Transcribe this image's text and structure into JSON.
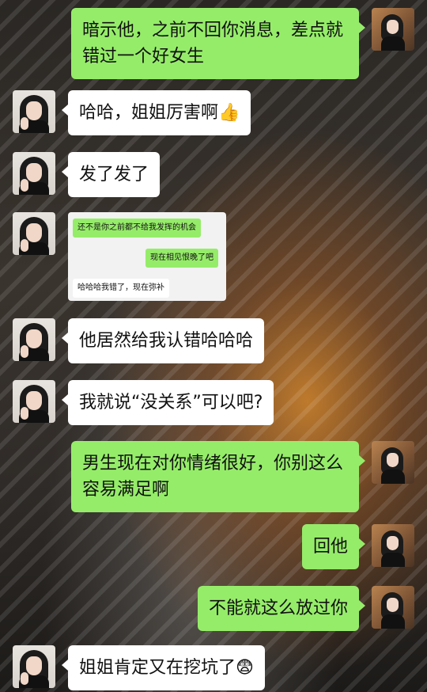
{
  "messages": [
    {
      "side": "me",
      "text": "暗示他，之前不回你消息，差点就错过一个好女生"
    },
    {
      "side": "them",
      "text": "哈哈，姐姐厉害啊",
      "emoji": "👍"
    },
    {
      "side": "them",
      "text": "发了发了"
    },
    {
      "side": "them",
      "type": "screenshot",
      "items": [
        {
          "side": "me",
          "text": "还不是你之前都不给我发挥的机会"
        },
        {
          "side": "me",
          "text": "现在相见恨晚了吧"
        },
        {
          "side": "them",
          "text": "哈哈哈我错了，现在弥补"
        }
      ]
    },
    {
      "side": "them",
      "text": "他居然给我认错哈哈哈"
    },
    {
      "side": "them",
      "text": "我就说“没关系”可以吧?"
    },
    {
      "side": "me",
      "text": "男生现在对你情绪很好，你别这么容易满足啊"
    },
    {
      "side": "me",
      "text": "回他"
    },
    {
      "side": "me",
      "text": "不能就这么放过你"
    },
    {
      "side": "them",
      "text": "姐姐肯定又在挖坑了",
      "emoji": "😨"
    }
  ],
  "colors": {
    "me_bubble": "#95ec69",
    "them_bubble": "#ffffff"
  }
}
